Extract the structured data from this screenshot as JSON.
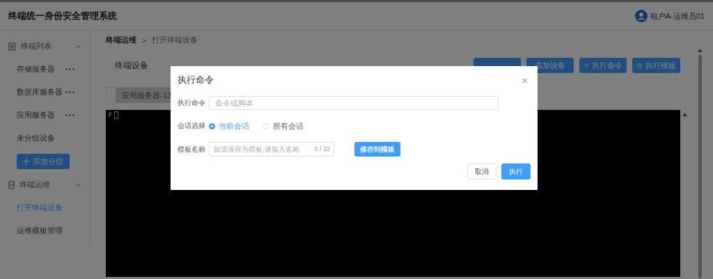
{
  "header": {
    "title": "终端统一身份安全管理系统",
    "user": "租户A-运维员01"
  },
  "sidebar": {
    "sections": [
      {
        "title": "终端列表",
        "kind": "list",
        "expanded": true,
        "items": [
          {
            "label": "存储服务器",
            "menu": true,
            "selected": false
          },
          {
            "label": "数据库服务器",
            "menu": true,
            "selected": false
          },
          {
            "label": "应用服务器",
            "menu": true,
            "selected": false
          },
          {
            "label": "未分组设备",
            "menu": false,
            "selected": false
          }
        ],
        "add_button": "添加分组"
      },
      {
        "title": "终端运维",
        "kind": "device",
        "expanded": true,
        "items": [
          {
            "label": "打开终端设备",
            "menu": false,
            "selected": true
          },
          {
            "label": "运维模板管理",
            "menu": false,
            "selected": false
          }
        ]
      }
    ]
  },
  "breadcrumb": {
    "items": [
      "终端运维",
      "打开终端设备"
    ],
    "separator": ">"
  },
  "page_title": "终端设备",
  "toolbar_buttons": [
    {
      "kind": "covered"
    },
    {
      "kind": "plain",
      "label": "添加设备"
    },
    {
      "kind": "run",
      "label": "执行命令"
    },
    {
      "kind": "star",
      "label": "执行模板"
    }
  ],
  "terminal": {
    "tab": "应用服务器-13",
    "prompt": "#"
  },
  "dialog": {
    "title": "执行命令",
    "close": "×",
    "command": {
      "label": "执行命令",
      "placeholder": "命令或脚本"
    },
    "session": {
      "label": "会话选择",
      "options": [
        {
          "label": "当前会话",
          "selected": true
        },
        {
          "label": "所有会话",
          "selected": false
        }
      ]
    },
    "template": {
      "label": "模板名称",
      "placeholder": "如需保存为模板,请输入名称",
      "count": "0 / 32",
      "save_button": "保存到模板"
    },
    "buttons": [
      {
        "kind": "secondary",
        "label": "取消"
      },
      {
        "kind": "primary",
        "label": "执行"
      }
    ]
  }
}
